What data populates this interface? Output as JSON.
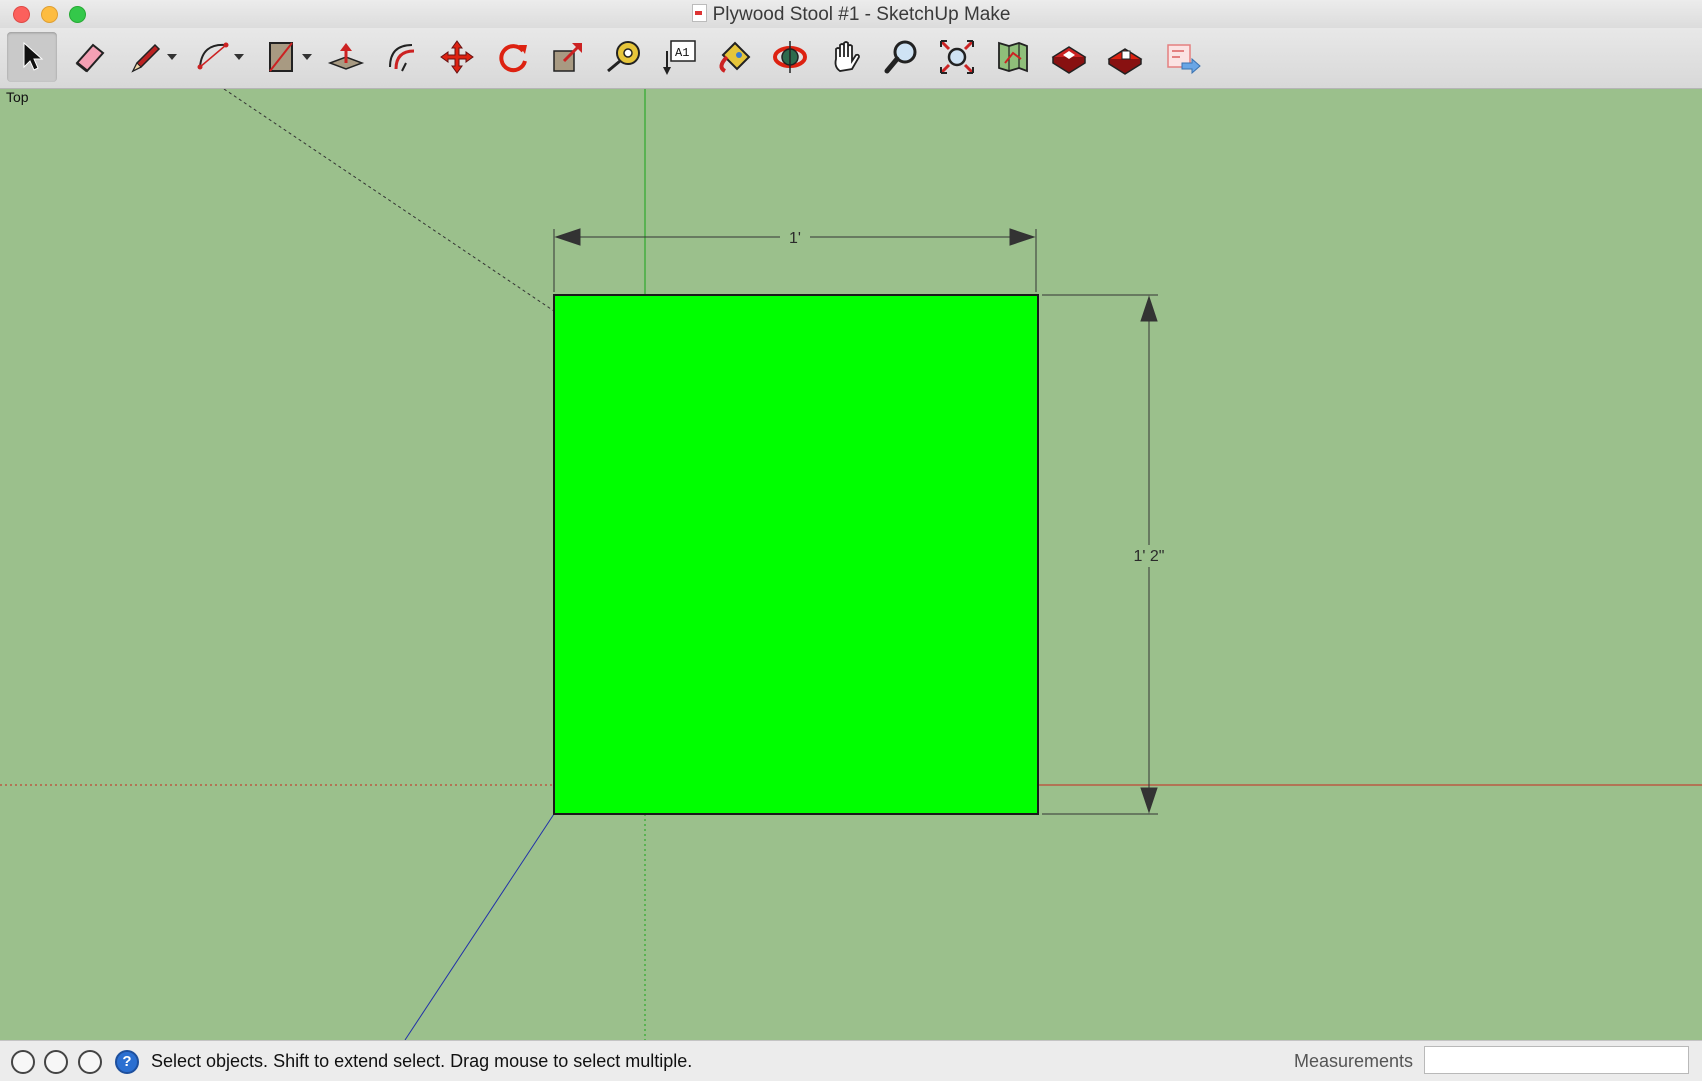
{
  "window": {
    "title": "Plywood Stool #1 - SketchUp Make"
  },
  "toolbar": {
    "tools": [
      {
        "name": "select",
        "icon": "arrow-cursor-icon",
        "active": true
      },
      {
        "name": "eraser",
        "icon": "eraser-icon"
      },
      {
        "name": "line",
        "icon": "pencil-icon",
        "has_dropdown": true
      },
      {
        "name": "arc",
        "icon": "arc-icon",
        "has_dropdown": true
      },
      {
        "name": "shapes",
        "icon": "rectangle-icon",
        "has_dropdown": true
      },
      {
        "name": "push-pull",
        "icon": "push-pull-icon"
      },
      {
        "name": "offset",
        "icon": "offset-icon"
      },
      {
        "name": "move",
        "icon": "move-icon"
      },
      {
        "name": "rotate",
        "icon": "rotate-icon"
      },
      {
        "name": "scale",
        "icon": "scale-icon"
      },
      {
        "name": "tape-measure",
        "icon": "tape-measure-icon"
      },
      {
        "name": "text",
        "icon": "text-icon",
        "label": "A1"
      },
      {
        "name": "paint-bucket",
        "icon": "paint-bucket-icon"
      },
      {
        "name": "orbit",
        "icon": "orbit-icon"
      },
      {
        "name": "pan",
        "icon": "hand-icon"
      },
      {
        "name": "zoom",
        "icon": "magnifier-icon"
      },
      {
        "name": "zoom-extents",
        "icon": "zoom-extents-icon"
      },
      {
        "name": "add-location",
        "icon": "map-location-icon"
      },
      {
        "name": "3d-warehouse",
        "icon": "warehouse-icon"
      },
      {
        "name": "extension-warehouse",
        "icon": "extension-warehouse-icon"
      },
      {
        "name": "send-to-layout",
        "icon": "send-to-layout-icon"
      }
    ]
  },
  "viewport": {
    "scene_label": "Top",
    "background_color": "#9bc08c",
    "face_color": "#00ff00",
    "dimensions": {
      "width_label": "1'",
      "height_label": "1' 2\""
    }
  },
  "statusbar": {
    "icons": [
      "geo-location-icon",
      "credits-icon",
      "user-account-icon",
      "help-icon"
    ],
    "help_glyph": "?",
    "message": "Select objects. Shift to extend select. Drag mouse to select multiple.",
    "measurements_label": "Measurements",
    "measurements_value": ""
  }
}
